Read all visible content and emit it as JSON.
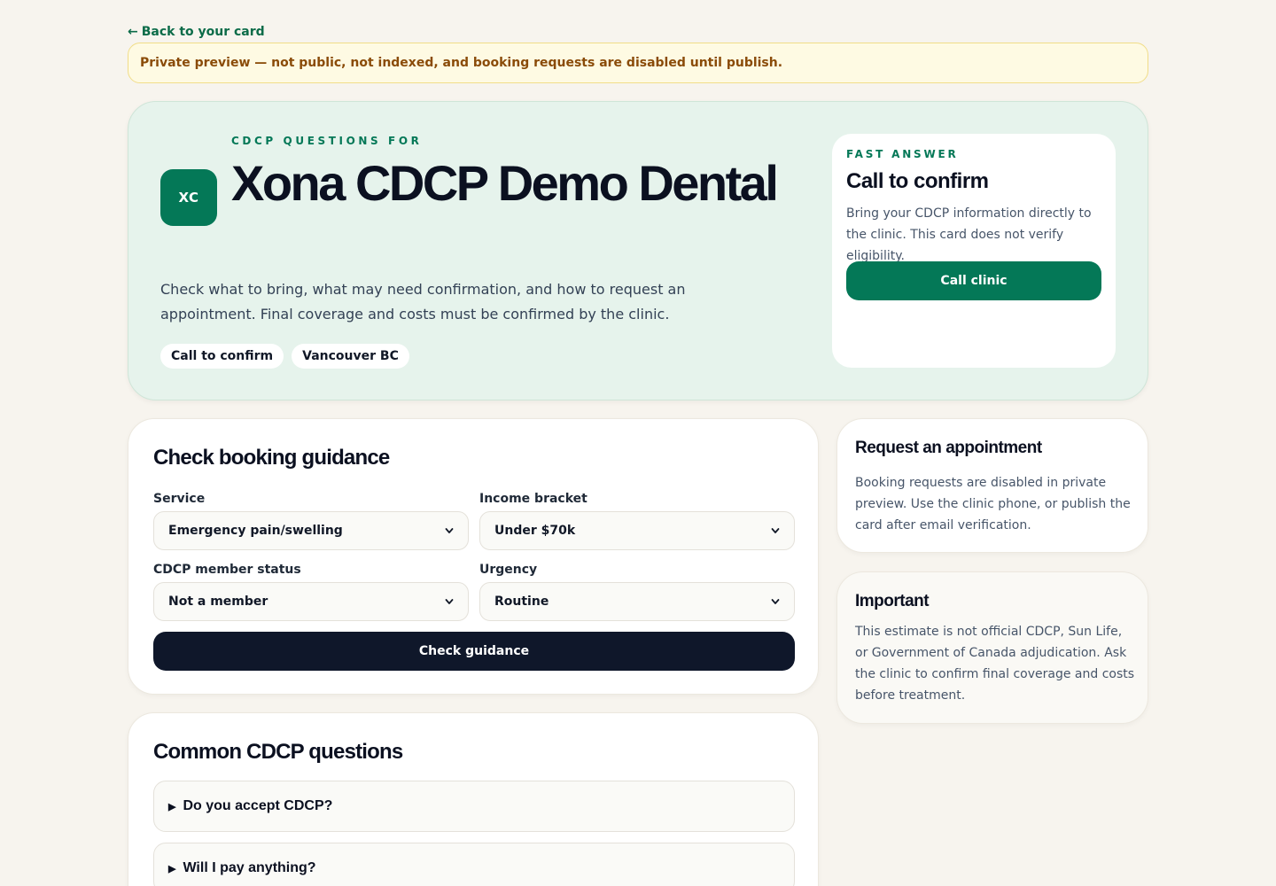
{
  "nav": {
    "back_arrow": "←",
    "back_label": "Back to your card"
  },
  "banner": {
    "text": "Private preview — not public, not indexed, and booking requests are disabled until publish."
  },
  "hero": {
    "logo_initials": "XC",
    "eyebrow": "CDCP QUESTIONS FOR",
    "title": "Xona CDCP Demo Dental",
    "description": "Check what to bring, what may need confirmation, and how to request an appointment. Final coverage and costs must be confirmed by the clinic.",
    "chips": [
      {
        "label": "Call to confirm"
      },
      {
        "label": "Vancouver BC"
      }
    ]
  },
  "fast_answer": {
    "eyebrow": "FAST ANSWER",
    "title": "Call to confirm",
    "body": "Bring your CDCP information directly to the clinic. This card does not verify eligibility.",
    "button_label": "Call clinic"
  },
  "guidance": {
    "title": "Check booking guidance",
    "fields": {
      "service": {
        "label": "Service",
        "value": "Emergency pain/swelling"
      },
      "income": {
        "label": "Income bracket",
        "value": "Under $70k"
      },
      "member": {
        "label": "CDCP member status",
        "value": "Not a member"
      },
      "urgency": {
        "label": "Urgency",
        "value": "Routine"
      }
    },
    "button_label": "Check guidance"
  },
  "faq": {
    "title": "Common CDCP questions",
    "items": [
      {
        "question": "Do you accept CDCP?"
      },
      {
        "question": "Will I pay anything?"
      }
    ]
  },
  "request": {
    "title": "Request an appointment",
    "body": "Booking requests are disabled in private preview. Use the clinic phone, or publish the card after email verification."
  },
  "important": {
    "title": "Important",
    "body": "This estimate is not official CDCP, Sun Life, or Government of Canada adjudication. Ask the clinic to confirm final coverage and costs before treatment."
  },
  "colors": {
    "brand_green": "#047857",
    "hero_bg": "#e6f3ec",
    "page_bg": "#f7f4ee",
    "dark_button": "#0f172a",
    "banner_bg": "#fefae3",
    "banner_text": "#8a4b08"
  },
  "icons": {
    "back": "arrow-left-icon",
    "select": "chevron-down-icon",
    "faq": "caret-right-icon"
  }
}
